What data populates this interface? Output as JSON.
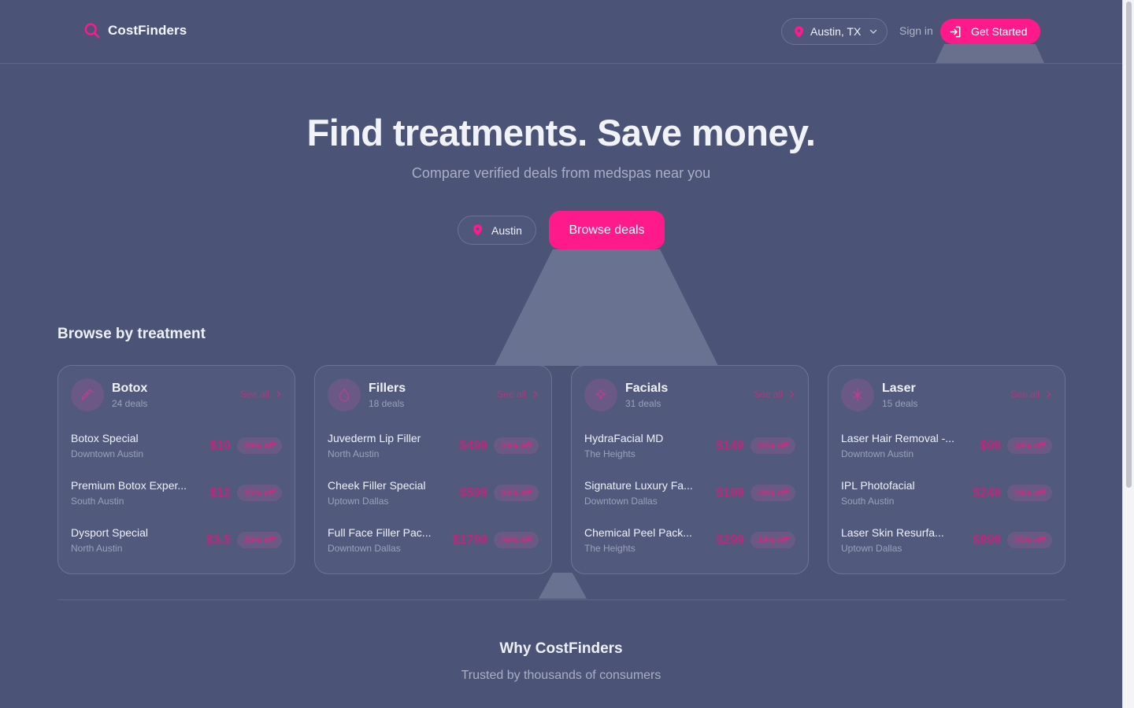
{
  "colors": {
    "accent": "#ff1a8c",
    "background": "#4b5476"
  },
  "header": {
    "brand": "CostFinders",
    "location": "Austin, TX",
    "sign_in": "Sign in",
    "get_started": "Get Started"
  },
  "hero": {
    "title": "Find treatments. Save money.",
    "subtitle": "Compare verified deals from medspas near you",
    "city": "Austin",
    "browse_button": "Browse deals"
  },
  "section": {
    "title": "Browse by treatment"
  },
  "categories": [
    {
      "name": "Botox",
      "count": "24 deals",
      "see_all": "See all",
      "icon": "syringe-icon",
      "deals": [
        {
          "name": "Botox Special",
          "location": "Downtown Austin",
          "price": "$10",
          "discount": "29% off"
        },
        {
          "name": "Premium Botox Exper...",
          "location": "South Austin",
          "price": "$12",
          "discount": "25% off"
        },
        {
          "name": "Dysport Special",
          "location": "North Austin",
          "price": "$3.5",
          "discount": "30% off"
        }
      ]
    },
    {
      "name": "Fillers",
      "count": "18 deals",
      "see_all": "See all",
      "icon": "droplet-icon",
      "deals": [
        {
          "name": "Juvederm Lip Filler",
          "location": "North Austin",
          "price": "$499",
          "discount": "23% off"
        },
        {
          "name": "Cheek Filler Special",
          "location": "Uptown Dallas",
          "price": "$599",
          "discount": "25% off"
        },
        {
          "name": "Full Face Filler Pac...",
          "location": "Downtown Dallas",
          "price": "$1799",
          "discount": "28% off"
        }
      ]
    },
    {
      "name": "Facials",
      "count": "31 deals",
      "see_all": "See all",
      "icon": "sparkle-icon",
      "deals": [
        {
          "name": "HydraFacial MD",
          "location": "The Heights",
          "price": "$149",
          "discount": "25% off"
        },
        {
          "name": "Signature Luxury Fa...",
          "location": "Downtown Dallas",
          "price": "$199",
          "discount": "28% off"
        },
        {
          "name": "Chemical Peel Pack...",
          "location": "The Heights",
          "price": "$299",
          "discount": "34% off"
        }
      ]
    },
    {
      "name": "Laser",
      "count": "15 deals",
      "see_all": "See all",
      "icon": "laser-icon",
      "deals": [
        {
          "name": "Laser Hair Removal -...",
          "location": "Downtown Austin",
          "price": "$99",
          "discount": "34% off"
        },
        {
          "name": "IPL Photofacial",
          "location": "South Austin",
          "price": "$249",
          "discount": "29% off"
        },
        {
          "name": "Laser Skin Resurfa...",
          "location": "Uptown Dallas",
          "price": "$899",
          "discount": "25% off"
        }
      ]
    }
  ],
  "why": {
    "title": "Why CostFinders",
    "subtitle": "Trusted by thousands of consumers"
  }
}
